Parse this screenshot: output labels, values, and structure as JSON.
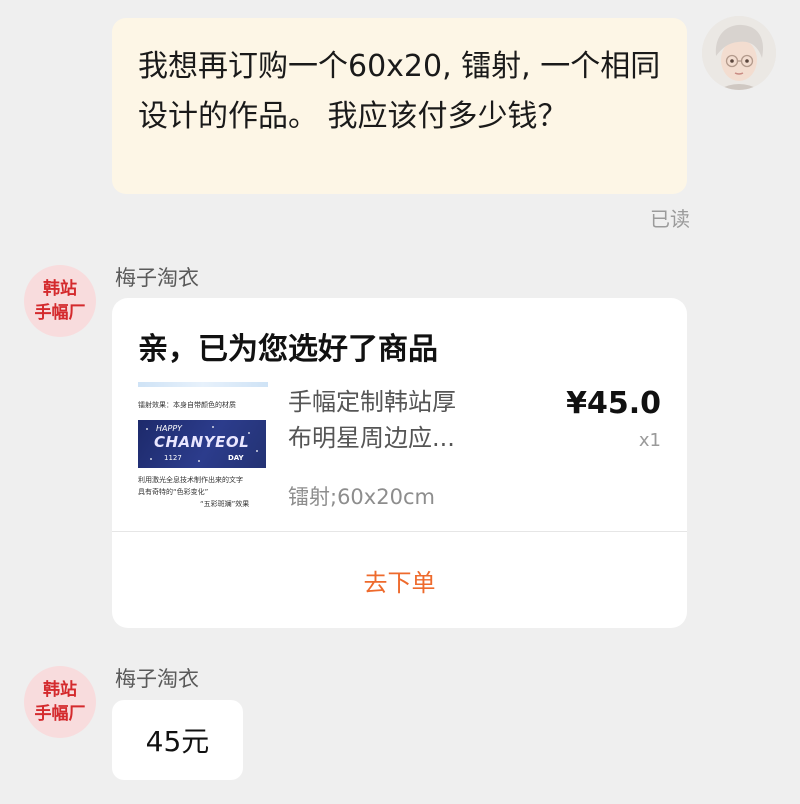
{
  "user_message": {
    "text": "我想再订购一个60x20, 镭射, 一个相同设计的作品。 我应该付多少钱？",
    "read_status": "已读"
  },
  "shop": {
    "avatar_line1": "韩站",
    "avatar_line2": "手幅厂",
    "name": "梅子淘衣"
  },
  "product_card": {
    "title": "亲，已为您选好了商品",
    "product_name": "手幅定制韩站厚\n布明星周边应...",
    "spec": "镭射;60x20cm",
    "price": "¥45.0",
    "quantity": "x1",
    "action_label": "去下单",
    "thumbnail": {
      "caption_top": "镭射效果：本身自带颜色的材质",
      "banner_line1": "HAPPY",
      "banner_line2": "CHANYEOL",
      "banner_date": "1127",
      "banner_day": "DAY",
      "caption_bottom1": "利用激光全息技术制作出来的文字",
      "caption_bottom2": "具有奇特的“色彩变化”",
      "caption_bottom3": "“五彩斑斓”效果"
    }
  },
  "reply_message": {
    "text": "45元"
  },
  "colors": {
    "background": "#efefef",
    "user_bubble": "#fdf6e6",
    "shop_avatar_bg": "#f8dcdd",
    "shop_avatar_text": "#d42a2d",
    "action_orange": "#ee6a2c"
  }
}
